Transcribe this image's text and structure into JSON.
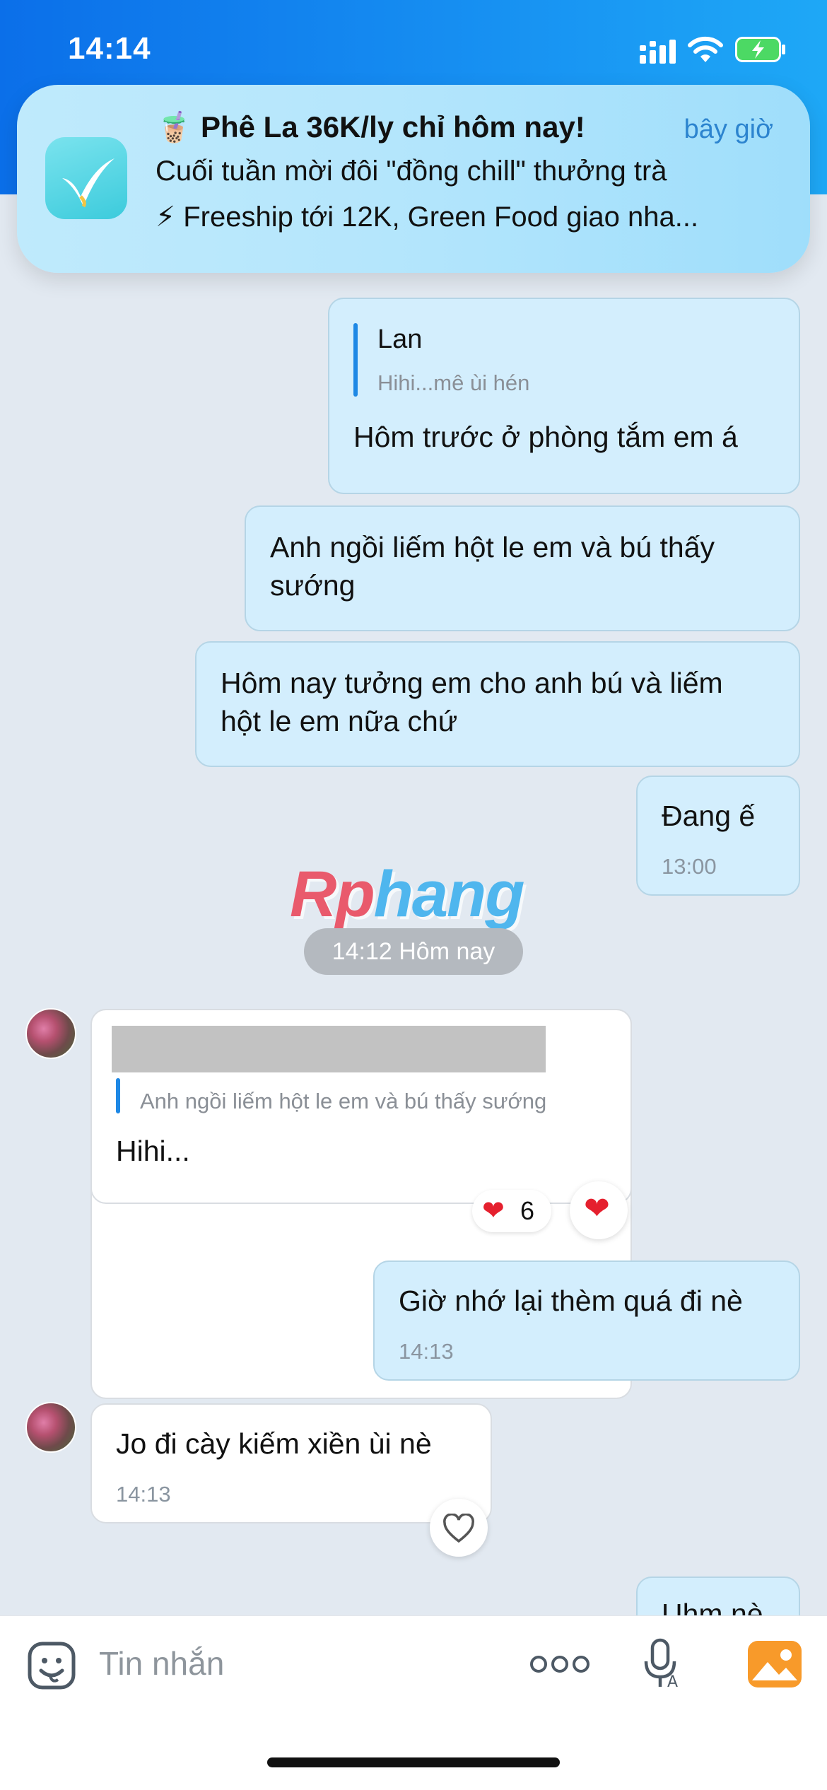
{
  "status_bar": {
    "time": "14:14"
  },
  "notification": {
    "emoji": "🧋",
    "title": "Phê La 36K/ly chỉ hôm nay!",
    "time": "bây giờ",
    "line1": "Cuối tuần mời đôi \"đồng chill\" thưởng trà",
    "line2": "⚡ Freeship tới 12K, Green Food giao nha..."
  },
  "messages": {
    "m1": {
      "quote_name": "Lan",
      "quote_text": "Hihi...mê ùi hén",
      "text": "Hôm trước ở phòng tắm em á"
    },
    "m2": {
      "line1": "Anh ngồi liếm hột le em và bú thấy",
      "line2": "sướng"
    },
    "m3": {
      "line1": "Hôm nay tưởng em cho anh bú và liếm",
      "line2": "hột le em nữa chứ"
    },
    "m4": {
      "text": "Đang ế",
      "time": "13:00"
    },
    "divider": "14:12 Hôm nay",
    "m5": {
      "quote_text": "Anh ngồi liếm hột le em và bú thấy sướng",
      "text": "Hihi...",
      "reaction_count": "6"
    },
    "m6": {
      "text": "Giờ nhớ lại thèm quá đi nè",
      "time": "14:13"
    },
    "m7": {
      "text": "Jo đi cày kiếm xiền ùi nè",
      "time": "14:13"
    },
    "m8": {
      "text": "Uhm nè"
    }
  },
  "watermark": {
    "part1": "Rp",
    "part2": "hang"
  },
  "input": {
    "placeholder": "Tin nhắn"
  },
  "colors": {
    "header": "#0b6fe9",
    "outgoing_bubble": "#d3eefd",
    "incoming_bubble": "#ffffff",
    "accent": "#1e88e5",
    "reaction": "#e5202e"
  }
}
